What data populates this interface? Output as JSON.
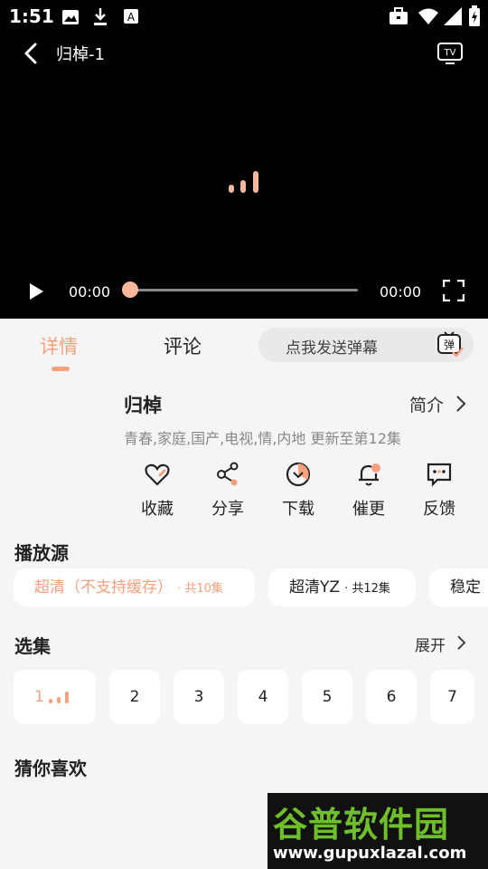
{
  "status_bar": {
    "time": "1:51"
  },
  "player": {
    "title": "归棹-1",
    "current_time": "00:00",
    "duration": "00:00",
    "progress": 0,
    "icons": [
      "back-icon",
      "tv-cast-icon",
      "loading-icon",
      "play-icon",
      "fullscreen-icon"
    ]
  },
  "tabs": {
    "details": "详情",
    "comments": "评论"
  },
  "danmaku": {
    "placeholder": "点我发送弹幕",
    "icon_label": "弹"
  },
  "show": {
    "title": "归棹",
    "intro_label": "简介",
    "tags": "青春,家庭,国产,电视,情,内地 更新至第12集"
  },
  "actions": [
    {
      "label": "收藏",
      "icon": "heart-icon"
    },
    {
      "label": "分享",
      "icon": "share-icon"
    },
    {
      "label": "下载",
      "icon": "download-icon"
    },
    {
      "label": "催更",
      "icon": "bell-icon"
    },
    {
      "label": "反馈",
      "icon": "feedback-icon"
    }
  ],
  "sources": {
    "title": "播放源",
    "items": [
      {
        "name": "超清（不支持缓存）",
        "count": "· 共10集"
      },
      {
        "name": "超清YZ",
        "count": "· 共12集"
      },
      {
        "name": "稳定"
      }
    ]
  },
  "episodes": {
    "title": "选集",
    "expand_label": "展开",
    "items": [
      "1",
      "2",
      "3",
      "4",
      "5",
      "6",
      "7"
    ]
  },
  "recommend": {
    "title": "猜你喜欢"
  },
  "watermark": {
    "name": "谷普软件园",
    "url": "www.gupuxlazal.com"
  },
  "colors": {
    "accent": "#f6a07d",
    "player_bg": "#000000",
    "page_bg": "#f5f5f5"
  }
}
